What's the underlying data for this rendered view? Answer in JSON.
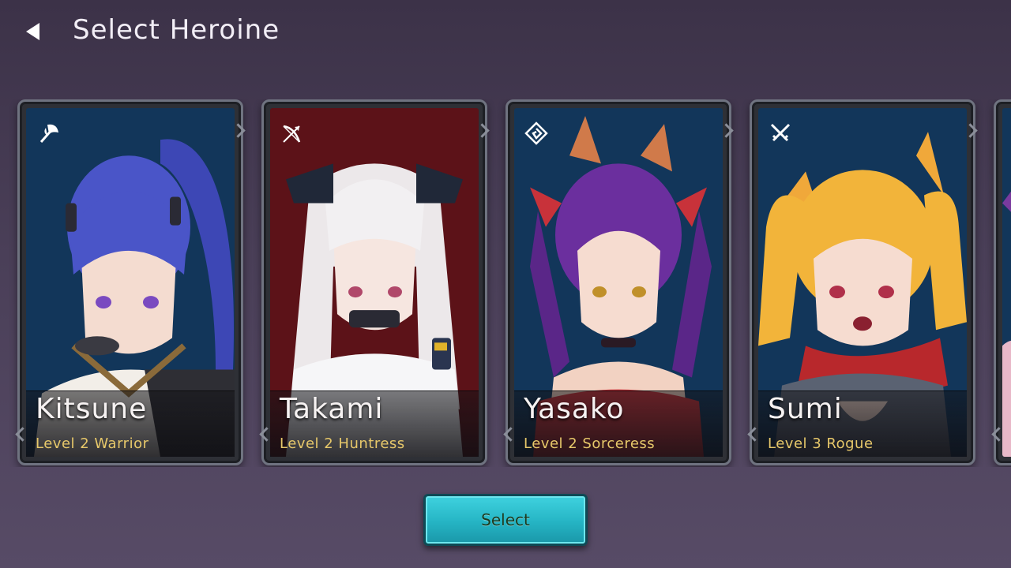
{
  "header": {
    "back_icon": "back-arrow-icon",
    "title": "Select Heroine"
  },
  "heroines": [
    {
      "name": "Kitsune",
      "level": "Level 2 Warrior",
      "class_icon": "axe-icon",
      "background": "#12365a",
      "hair": "#4a55c8",
      "accent": "#8a6a3a"
    },
    {
      "name": "Takami",
      "level": "Level 2 Huntress",
      "class_icon": "bow-icon",
      "background": "#5c1218",
      "hair": "#ece8ea",
      "accent": "#2a3550"
    },
    {
      "name": "Yasako",
      "level": "Level 2 Sorceress",
      "class_icon": "spiral-icon",
      "background": "#12365a",
      "hair": "#6b2f9e",
      "accent": "#c8323a"
    },
    {
      "name": "Sumi",
      "level": "Level 3 Rogue",
      "class_icon": "crossed-swords-icon",
      "background": "#12365a",
      "hair": "#f2b43a",
      "accent": "#b8282c"
    }
  ],
  "select_button": {
    "label": "Select"
  },
  "colors": {
    "background_top": "#3c3248",
    "background_bottom": "#574b66",
    "level_text": "#e7c86a",
    "button": "#2fc3d1"
  }
}
